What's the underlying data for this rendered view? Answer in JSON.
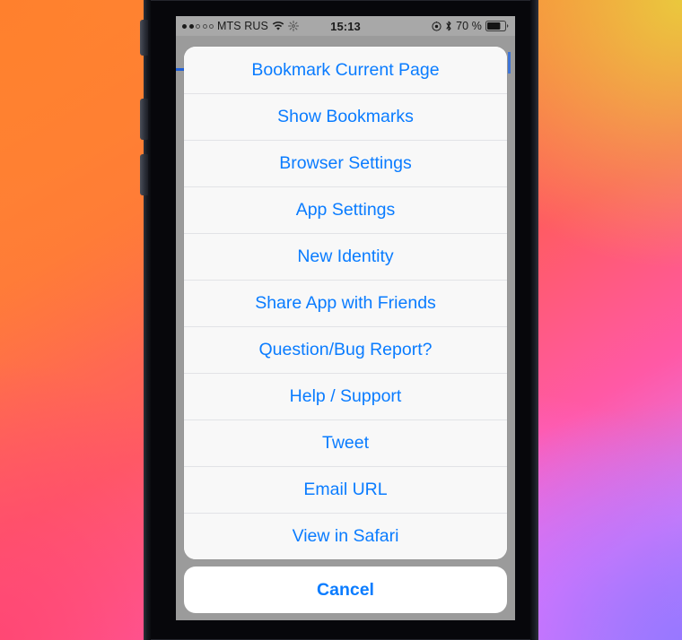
{
  "status_bar": {
    "signal_dots_filled": 2,
    "signal_dots_total": 5,
    "carrier": "MTS RUS",
    "wifi_icon": "wifi-icon",
    "sync_icon": "sync-spinner-icon",
    "time": "15:13",
    "location_icon": "location-services-icon",
    "bluetooth_icon": "bluetooth-icon",
    "battery_percent": "70 %",
    "battery_level": 70,
    "battery_icon": "battery-icon"
  },
  "action_sheet": {
    "items": [
      {
        "label": "Bookmark Current Page"
      },
      {
        "label": "Show Bookmarks"
      },
      {
        "label": "Browser Settings"
      },
      {
        "label": "App Settings"
      },
      {
        "label": "New Identity"
      },
      {
        "label": "Share App with Friends"
      },
      {
        "label": "Question/Bug Report?"
      },
      {
        "label": "Help / Support"
      },
      {
        "label": "Tweet"
      },
      {
        "label": "Email URL"
      },
      {
        "label": "View in Safari"
      }
    ],
    "cancel_label": "Cancel"
  },
  "colors": {
    "tint": "#0a7cff",
    "sheet_background": "#f8f8f8",
    "separator": "#e2e3e6",
    "cancel_background": "#ffffff",
    "status_bar_background": "#a8a8a8",
    "page_behind": "#9b9b9b",
    "progress": "#1f5fd8"
  }
}
